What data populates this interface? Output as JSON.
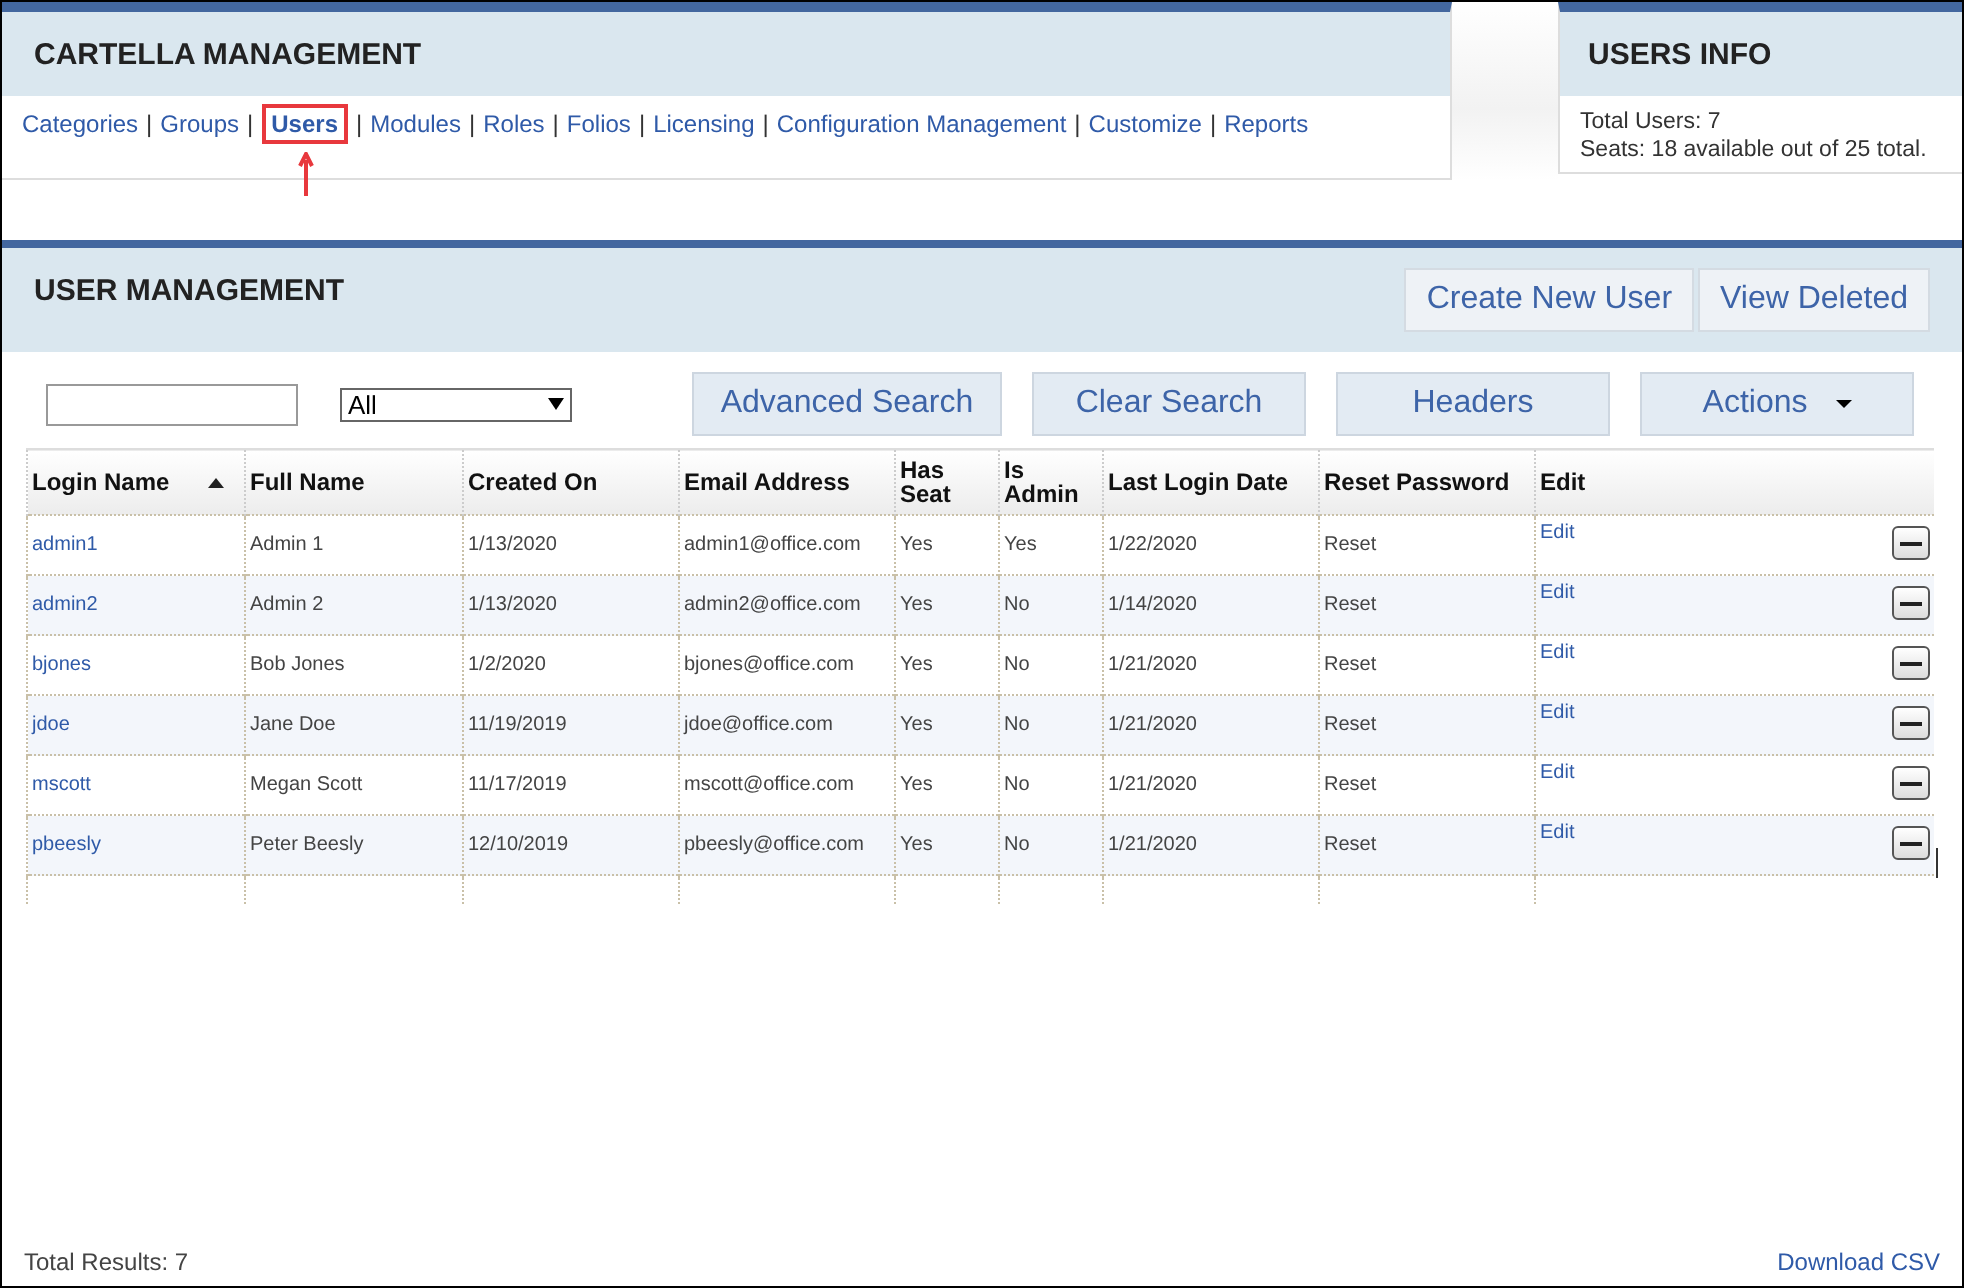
{
  "management_panel": {
    "title": "CARTELLA MANAGEMENT",
    "separator": "|",
    "nav": [
      {
        "label": "Categories",
        "selected": false
      },
      {
        "label": "Groups",
        "selected": false
      },
      {
        "label": "Users",
        "selected": true
      },
      {
        "label": "Modules",
        "selected": false
      },
      {
        "label": "Roles",
        "selected": false
      },
      {
        "label": "Folios",
        "selected": false
      },
      {
        "label": "Licensing",
        "selected": false
      },
      {
        "label": "Configuration Management",
        "selected": false
      },
      {
        "label": "Customize",
        "selected": false
      },
      {
        "label": "Reports",
        "selected": false
      }
    ]
  },
  "info_panel": {
    "title": "USERS INFO",
    "lines": [
      "Total Users: 7",
      "Seats: 18 available out of 25 total."
    ]
  },
  "user_management": {
    "title": "USER MANAGEMENT",
    "header_buttons": [
      "Create New User",
      "View Deleted"
    ],
    "filter": {
      "select_value": "All"
    },
    "toolbar_buttons": [
      {
        "label": "Advanced Search",
        "kind": "plain"
      },
      {
        "label": "Clear Search",
        "kind": "plain"
      },
      {
        "label": "Headers",
        "kind": "plain"
      },
      {
        "label": "Actions",
        "kind": "dropdown"
      }
    ],
    "table": {
      "columns": [
        {
          "label": "Login Name",
          "sorted": true
        },
        {
          "label": "Full Name",
          "sorted": false
        },
        {
          "label": "Created On",
          "sorted": false
        },
        {
          "label": "Email Address",
          "sorted": false
        },
        {
          "label": "Has Seat",
          "sorted": false
        },
        {
          "label": "Is Admin",
          "sorted": false
        },
        {
          "label": "Last Login Date",
          "sorted": false
        },
        {
          "label": "Reset Password",
          "sorted": false
        },
        {
          "label": "Edit",
          "sorted": false
        }
      ],
      "rows": [
        [
          "admin1",
          "Admin 1",
          "1/13/2020",
          "admin1@office.com",
          "Yes",
          "Yes",
          "1/22/2020",
          "Reset",
          "Edit"
        ],
        [
          "admin2",
          "Admin 2",
          "1/13/2020",
          "admin2@office.com",
          "Yes",
          "No",
          "1/14/2020",
          "Reset",
          "Edit"
        ],
        [
          "bjones",
          "Bob Jones",
          "1/2/2020",
          "bjones@office.com",
          "Yes",
          "No",
          "1/21/2020",
          "Reset",
          "Edit"
        ],
        [
          "jdoe",
          "Jane Doe",
          "11/19/2019",
          "jdoe@office.com",
          "Yes",
          "No",
          "1/21/2020",
          "Reset",
          "Edit"
        ],
        [
          "mscott",
          "Megan Scott",
          "11/17/2019",
          "mscott@office.com",
          "Yes",
          "No",
          "1/21/2020",
          "Reset",
          "Edit"
        ],
        [
          "pbeesly",
          "Peter Beesly",
          "12/10/2019",
          "pbeesly@office.com",
          "Yes",
          "No",
          "1/21/2020",
          "Reset",
          "Edit"
        ]
      ]
    },
    "footer": {
      "total": "Total Results: 7",
      "download": "Download CSV"
    }
  }
}
